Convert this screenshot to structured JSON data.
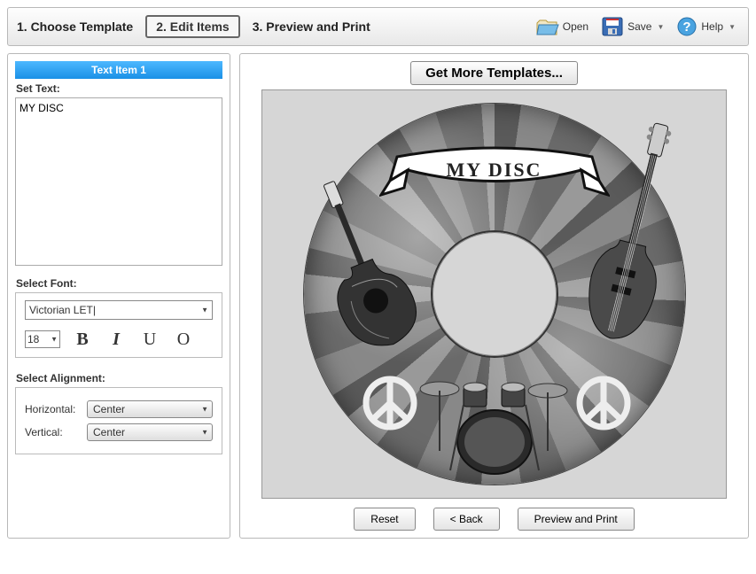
{
  "wizard": {
    "step1": "1. Choose Template",
    "step2": "2. Edit Items",
    "step3": "3. Preview and Print"
  },
  "toolbar": {
    "open": "Open",
    "save": "Save",
    "help": "Help"
  },
  "editor": {
    "item_header": "Text Item 1",
    "set_text_label": "Set Text:",
    "text_value": "MY DISC",
    "select_font_label": "Select Font:",
    "font_name": "Victorian LET|",
    "font_size": "18",
    "select_alignment_label": "Select Alignment:",
    "horizontal_label": "Horizontal:",
    "horizontal_value": "Center",
    "vertical_label": "Vertical:",
    "vertical_value": "Center"
  },
  "preview": {
    "get_more": "Get More Templates...",
    "disc_text": "MY DISC"
  },
  "buttons": {
    "reset": "Reset",
    "back": "< Back",
    "preview_print": "Preview and Print"
  }
}
